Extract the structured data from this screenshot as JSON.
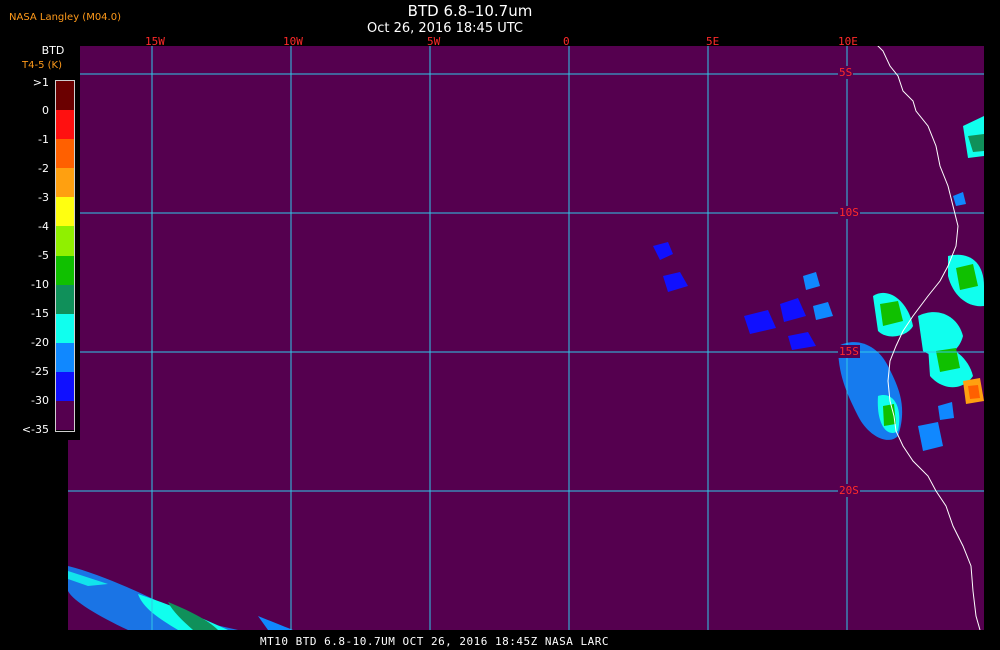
{
  "header": {
    "title": "BTD 6.8–10.7um",
    "subtitle": "Oct 26, 2016 18:45 UTC",
    "source": "NASA Langley (M04.0)"
  },
  "legend": {
    "title": "BTD",
    "subtitle": "T4-5 (K)",
    "labels": [
      ">1",
      "0",
      "-1",
      "-2",
      "-3",
      "-4",
      "-5",
      "-10",
      "-15",
      "-20",
      "-25",
      "-30",
      "<-35"
    ],
    "colors": [
      "#6b0000",
      "#ff1010",
      "#ff6000",
      "#ffa010",
      "#ffff10",
      "#90f000",
      "#10c000",
      "#10905a",
      "#10ffee",
      "#1088ff",
      "#1010ff",
      "#55004f"
    ]
  },
  "map": {
    "lon_labels": [
      "15W",
      "10W",
      "5W",
      "0",
      "5E",
      "10E"
    ],
    "lat_labels": [
      "5S",
      "10S",
      "15S",
      "20S"
    ],
    "background_color": "#55004f",
    "grid_color": "#30c8e8",
    "coast_color": "#ffffff"
  },
  "footer": {
    "text": "MT10   BTD 6.8-10.7UM    OCT 26, 2016 18:45Z   NASA LARC"
  }
}
